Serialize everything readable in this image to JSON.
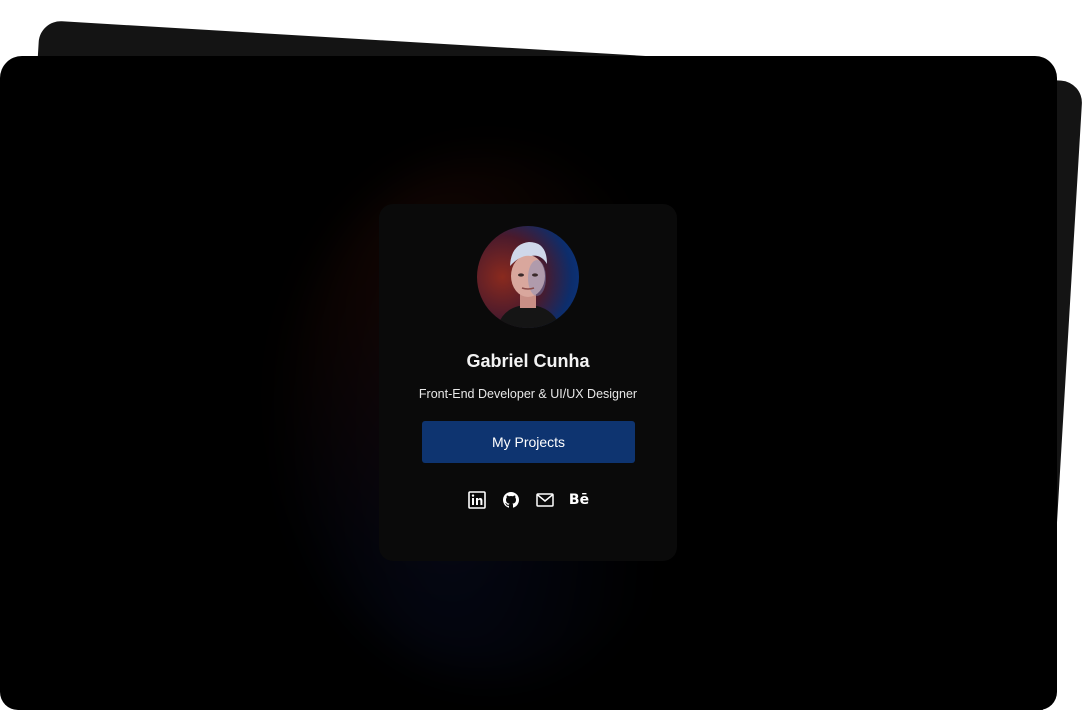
{
  "profile": {
    "name": "Gabriel Cunha",
    "role": "Front-End Developer & UI/UX Designer",
    "avatar": "portrait-photo"
  },
  "actions": {
    "projects_label": "My Projects"
  },
  "socials": [
    {
      "icon": "linkedin-icon"
    },
    {
      "icon": "github-icon"
    },
    {
      "icon": "mail-icon"
    },
    {
      "icon": "behance-icon",
      "label": "Bē"
    }
  ],
  "colors": {
    "background": "#000000",
    "card": "#0a0a0a",
    "accent": "#0e3470",
    "text": "#f2f2f2"
  }
}
